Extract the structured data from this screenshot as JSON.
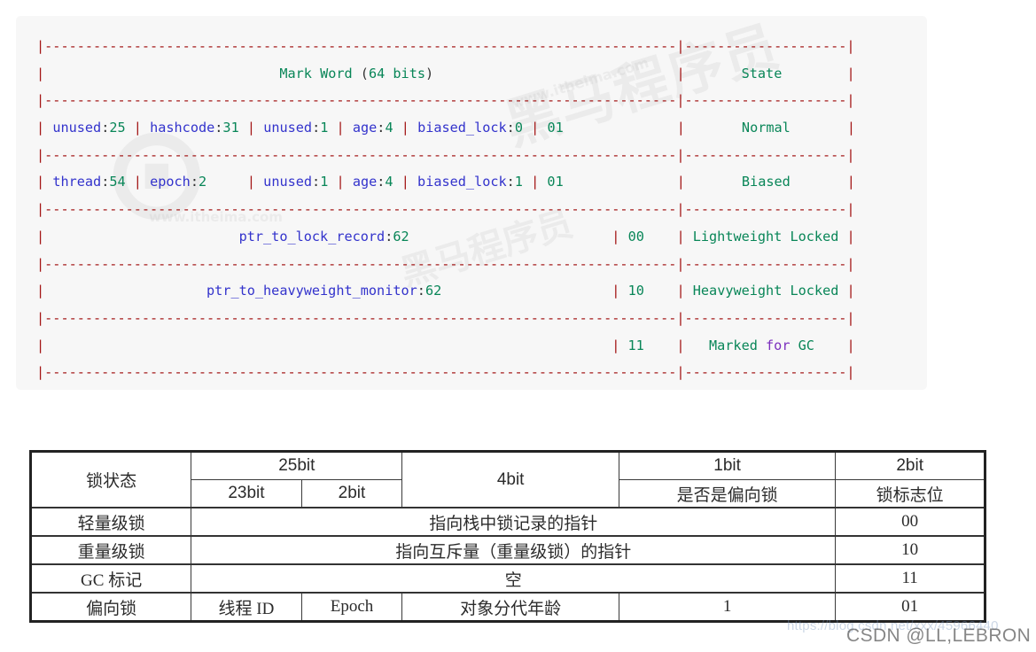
{
  "code_block": {
    "language": "plaintext",
    "background": "#f7f7f7",
    "colors": {
      "pipe": "#a31515",
      "identifier": "#3333cc",
      "number": "#098658",
      "word": "#098658",
      "keyword": "#7b2fbe",
      "plain": "#333333"
    },
    "lines": [
      {
        "id": "sep-top",
        "kind": "separator",
        "text": "|-------------------------------------------------------------|------------------|"
      },
      {
        "id": "header",
        "kind": "content",
        "text": "|                     Mark Word (64 bits)                       |       State      |",
        "cells": [
          "Mark Word (64 bits)",
          "State"
        ]
      },
      {
        "id": "sep-1",
        "kind": "separator",
        "text": "|-------------------------------------------------------------|------------------|"
      },
      {
        "id": "row-normal",
        "kind": "content",
        "text": "| unused:25 | hashcode:31 | unused:1 | age:4 | biased_lock:0 | 01    |      Normal      |",
        "fields": [
          "unused:25",
          "hashcode:31",
          "unused:1",
          "age:4",
          "biased_lock:0",
          "01"
        ],
        "state": "Normal"
      },
      {
        "id": "sep-2",
        "kind": "separator",
        "text": "|-------------------------------------------------------------|------------------|"
      },
      {
        "id": "row-biased",
        "kind": "content",
        "text": "| thread:54 | epoch:2     | unused:1 | age:4 | biased_lock:1 | 01    |      Biased      |",
        "fields": [
          "thread:54",
          "epoch:2",
          "unused:1",
          "age:4",
          "biased_lock:1",
          "01"
        ],
        "state": "Biased"
      },
      {
        "id": "sep-3",
        "kind": "separator",
        "text": "|-------------------------------------------------------------|------------------|"
      },
      {
        "id": "row-lightweight",
        "kind": "content",
        "text": "|            ptr_to_lock_record:62                  | 00    | Lightweight Locked |",
        "fields": [
          "ptr_to_lock_record:62",
          "00"
        ],
        "state": "Lightweight Locked"
      },
      {
        "id": "sep-4",
        "kind": "separator",
        "text": "|-------------------------------------------------------------|------------------|"
      },
      {
        "id": "row-heavyweight",
        "kind": "content",
        "text": "|         ptr_to_heavyweight_monitor:62             | 10    | Heavyweight Locked |",
        "fields": [
          "ptr_to_heavyweight_monitor:62",
          "10"
        ],
        "state": "Heavyweight Locked"
      },
      {
        "id": "sep-5",
        "kind": "separator",
        "text": "|-------------------------------------------------------------|------------------|"
      },
      {
        "id": "row-gc",
        "kind": "content",
        "text": "|                                                   | 11    |   Marked for GC    |",
        "fields": [
          "",
          "11"
        ],
        "state": "Marked for GC"
      },
      {
        "id": "sep-bottom",
        "kind": "separator",
        "text": "|-------------------------------------------------------------|------------------|"
      }
    ]
  },
  "lock_table": {
    "header": {
      "state_col": "锁状态",
      "group_25bit": "25bit",
      "sub_23bit": "23bit",
      "sub_2bit": "2bit",
      "group_4bit": "4bit",
      "group_1bit": "1bit",
      "sub_1bit_label": "是否是偏向锁",
      "group_2bit": "2bit",
      "sub_2bit_label": "锁标志位"
    },
    "rows": [
      {
        "state": "轻量级锁",
        "span_text": "指向栈中锁记录的指针",
        "span": 4,
        "flag": "00",
        "cells": null
      },
      {
        "state": "重量级锁",
        "span_text": "指向互斥量（重量级锁）的指针",
        "span": 4,
        "flag": "10",
        "cells": null
      },
      {
        "state": "GC 标记",
        "span_text": "空",
        "span": 4,
        "flag": "11",
        "cells": null
      },
      {
        "state": "偏向锁",
        "span_text": null,
        "span": 0,
        "flag": "01",
        "cells": [
          "线程 ID",
          "Epoch",
          "对象分代年龄",
          "1"
        ]
      }
    ]
  },
  "watermarks": {
    "code_cn_big": "黑马程序员",
    "code_cn_tm": "™",
    "code_site": "www.itheima.com",
    "code_circle": "⊙",
    "blog_url": "https://blog.csdn.net/xxx/45966440",
    "csdn_credit": "CSDN @LL,LEBRON"
  }
}
